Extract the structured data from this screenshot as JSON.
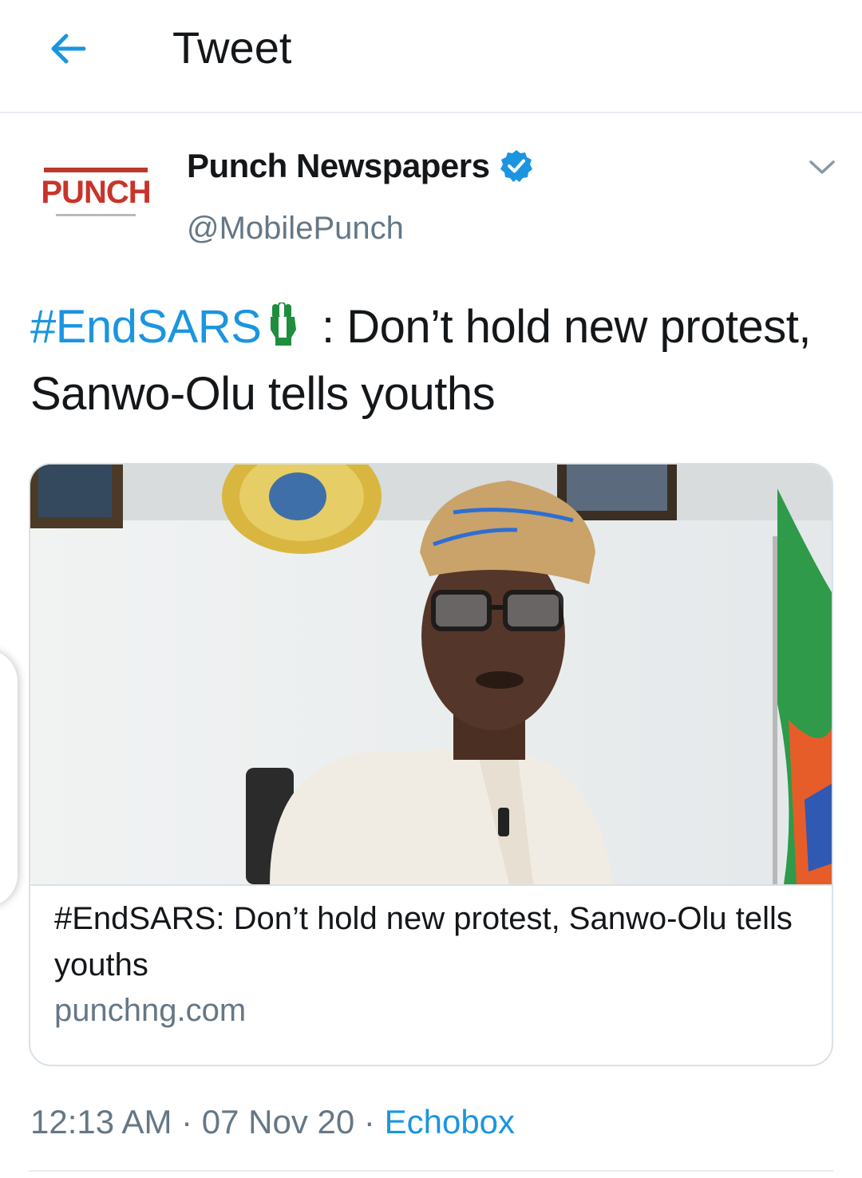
{
  "header": {
    "title": "Tweet",
    "back_icon": "arrow-left-icon"
  },
  "author": {
    "avatar_text": "PUNCH",
    "name": "Punch Newspapers",
    "handle": "@MobilePunch",
    "verified_icon": "verified-badge-icon"
  },
  "tweet": {
    "hashtag": "#EndSARS",
    "emoji": "raised-fist-icon",
    "text": " : Don’t hold new protest, Sanwo-Olu tells youths"
  },
  "card": {
    "title": "#EndSARS: Don’t hold new protest, Sanwo-Olu tells youths",
    "domain": "punchng.com"
  },
  "meta": {
    "time": "12:13 AM",
    "separator": " · ",
    "date": "07 Nov 20",
    "source": "Echobox"
  },
  "colors": {
    "accent": "#1b95e0",
    "text": "#14171a",
    "secondary": "#657786",
    "divider": "#e6ecf0",
    "brand_red": "#c8342a"
  }
}
